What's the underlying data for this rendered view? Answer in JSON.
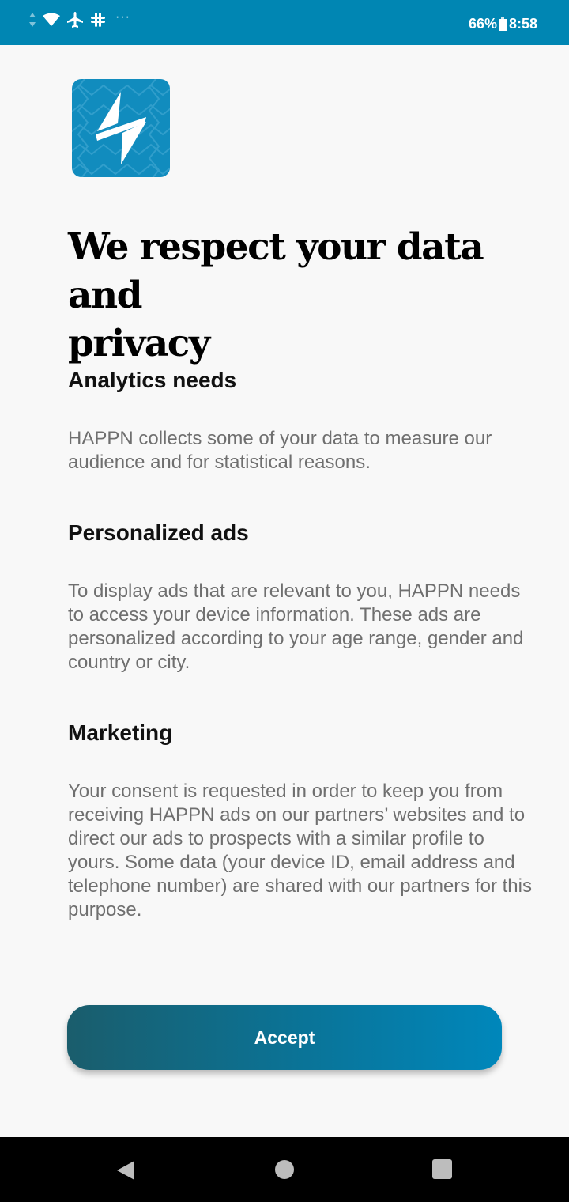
{
  "status_bar": {
    "battery": "66%",
    "time": "8:58",
    "more_indicator": "···",
    "icons": [
      "data-arrows-icon",
      "wifi-icon",
      "airplane-mode-icon",
      "slack-icon"
    ]
  },
  "app": {
    "logo_icon": "happn-lightning-logo-icon",
    "brand_color": "#118cbe"
  },
  "heading": {
    "line1": "We respect your data and",
    "line2": "privacy"
  },
  "sections": [
    {
      "title": "Analytics needs",
      "body": "HAPPN collects some of your data to measure our audience and for statistical reasons."
    },
    {
      "title": "Personalized ads",
      "body": "To display ads that are relevant to you, HAPPN needs to access your device information. These ads are personalized according to your age range, gender and country or city."
    },
    {
      "title": "Marketing",
      "body": "Your consent is requested in order to keep you from receiving HAPPN ads on our partners’ websites and to direct our ads to prospects with a similar profile to yours. Some data (your device ID, email address and telephone number) are shared with our partners for this purpose."
    }
  ],
  "accept_button": {
    "label": "Accept",
    "gradient_start": "#1a5d6c",
    "gradient_end": "#0087bb"
  },
  "nav_bar": {
    "icons": [
      "back-icon",
      "home-icon",
      "recents-icon"
    ]
  }
}
